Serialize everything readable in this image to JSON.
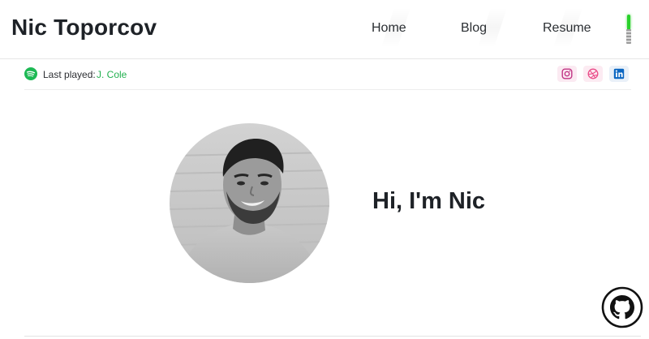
{
  "site": {
    "title": "Nic Toporcov"
  },
  "nav": {
    "items": [
      {
        "label": "Home"
      },
      {
        "label": "Blog"
      },
      {
        "label": "Resume"
      }
    ]
  },
  "now_playing": {
    "label": "Last played:",
    "artist": "J. Cole",
    "icon": "spotify-icon",
    "accent": "#1DB954"
  },
  "social": [
    {
      "name": "instagram-icon",
      "color": "#C13584"
    },
    {
      "name": "dribbble-icon",
      "color": "#EA4C89"
    },
    {
      "name": "linkedin-icon",
      "color": "#0A66C2"
    }
  ],
  "hero": {
    "heading": "Hi, I'm Nic",
    "avatar": "profile-photo"
  },
  "corner": {
    "icon": "github-icon"
  }
}
